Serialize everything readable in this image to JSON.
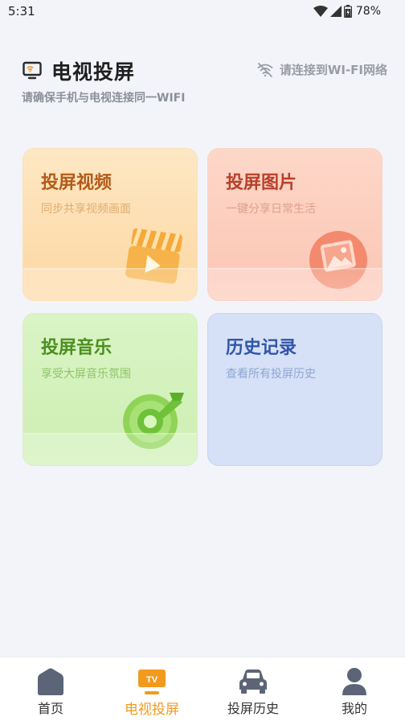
{
  "status_bar": {
    "time": "5:31",
    "battery": "78%"
  },
  "header": {
    "title": "电视投屏",
    "subtitle": "请确保手机与电视连接同一WIFI",
    "wifi_status": "请连接到WI-FI网络"
  },
  "cards": [
    {
      "title": "投屏视频",
      "desc": "同步共享视频画面",
      "icon": "clapperboard-play-icon"
    },
    {
      "title": "投屏图片",
      "desc": "一键分享日常生活",
      "icon": "picture-icon"
    },
    {
      "title": "投屏音乐",
      "desc": "享受大屏音乐氛围",
      "icon": "music-disc-icon"
    },
    {
      "title": "历史记录",
      "desc": "查看所有投屏历史"
    }
  ],
  "bottom_nav": [
    {
      "label": "首页",
      "icon": "home-icon"
    },
    {
      "label": "电视投屏",
      "icon": "tv-icon",
      "active": true
    },
    {
      "label": "投屏历史",
      "icon": "car-icon"
    },
    {
      "label": "我的",
      "icon": "user-icon"
    }
  ],
  "colors": {
    "accent": "#f29a1f",
    "background": "#f3f4fa",
    "nav_icon": "#5c6577"
  }
}
